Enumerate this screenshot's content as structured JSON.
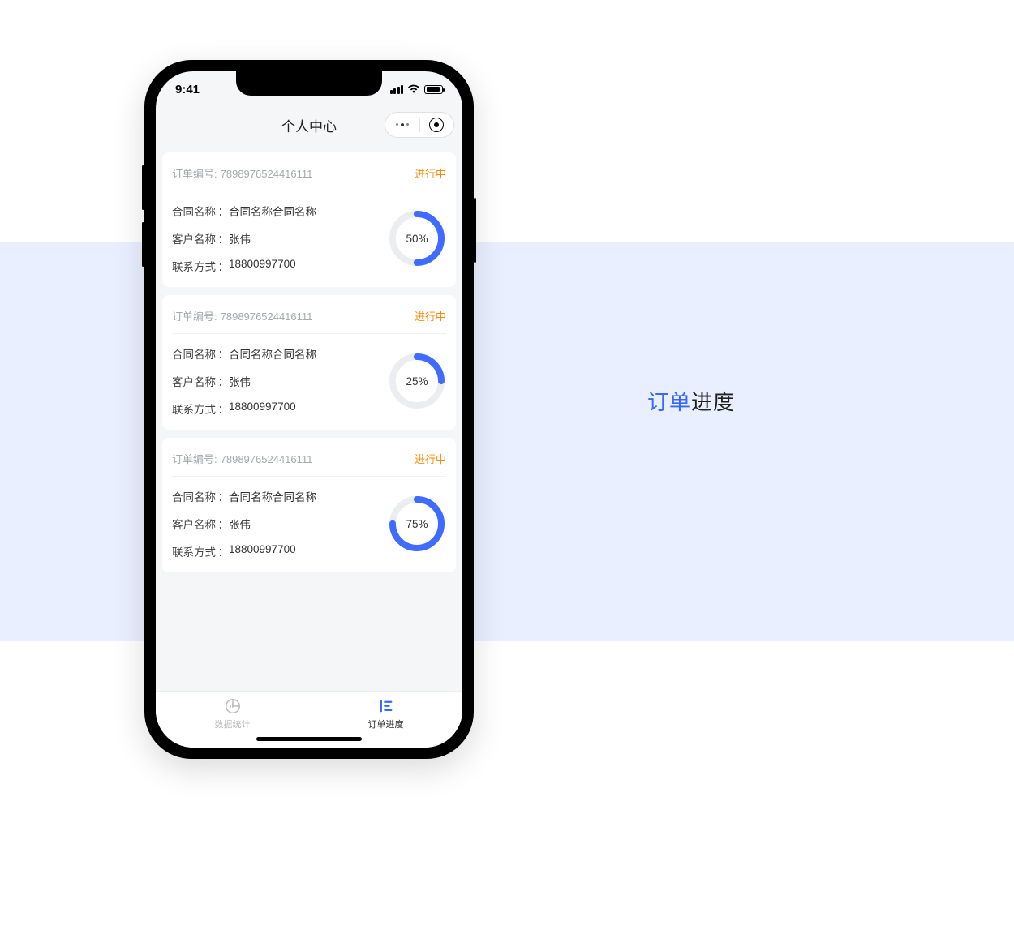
{
  "status_bar": {
    "time": "9:41"
  },
  "header": {
    "title": "个人中心"
  },
  "labels": {
    "order_no": "订单编号",
    "contract": "合同名称",
    "customer": "客户名称",
    "contact": "联系方式"
  },
  "orders": [
    {
      "order_no": "7898976524416111",
      "status": "进行中",
      "contract": "合同名称合同名称",
      "customer": "张伟",
      "contact": "18800997700",
      "progress": 50,
      "progress_label": "50%"
    },
    {
      "order_no": "7898976524416111",
      "status": "进行中",
      "contract": "合同名称合同名称",
      "customer": "张伟",
      "contact": "18800997700",
      "progress": 25,
      "progress_label": "25%"
    },
    {
      "order_no": "7898976524416111",
      "status": "进行中",
      "contract": "合同名称合同名称",
      "customer": "张伟",
      "contact": "18800997700",
      "progress": 75,
      "progress_label": "75%"
    }
  ],
  "tabs": [
    {
      "label": "数据统计",
      "active": false
    },
    {
      "label": "订单进度",
      "active": true
    }
  ],
  "side_title": {
    "accent": "订单",
    "rest": "进度"
  },
  "colors": {
    "accent": "#3568ff",
    "status": "#ff8a00",
    "ring_track": "#ecedf1",
    "ring_fill": "#3f6cff"
  }
}
